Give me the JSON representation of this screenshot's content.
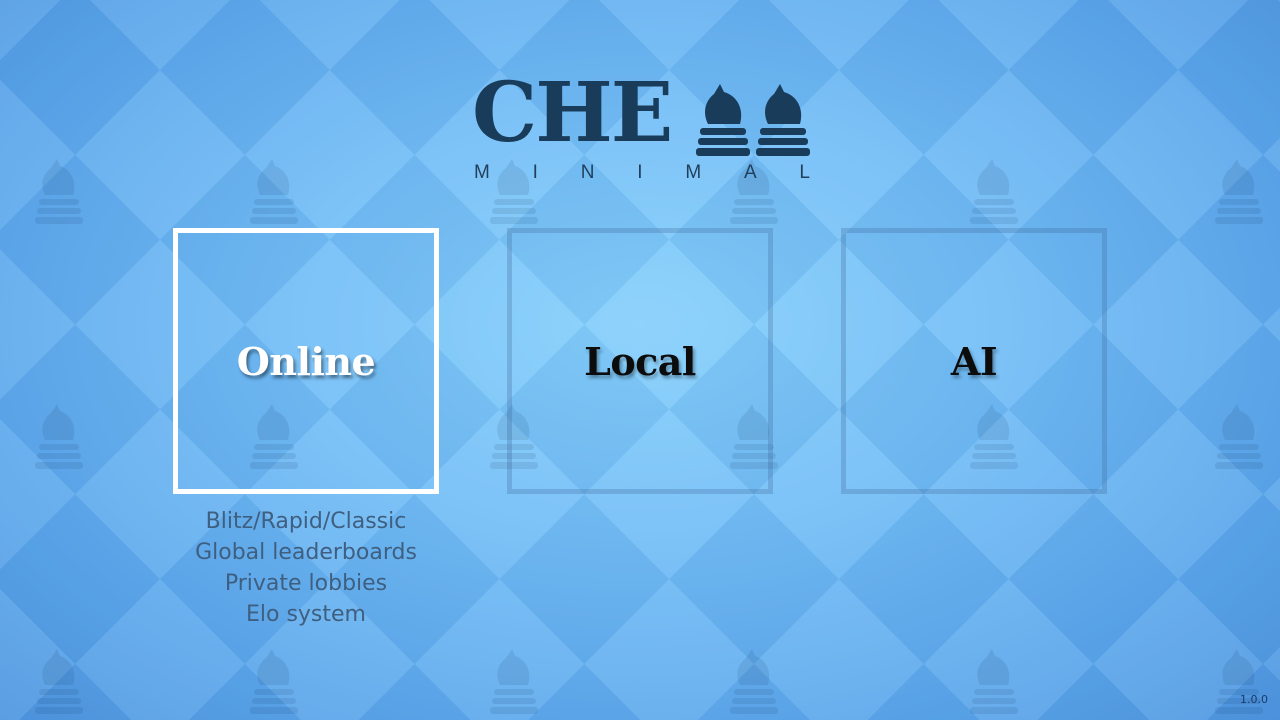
{
  "logo": {
    "word": "CHE",
    "subtitle_letters": [
      "M",
      "I",
      "N",
      "I",
      "M",
      "A",
      "L"
    ],
    "knight_icons": [
      "knight-icon",
      "knight-icon"
    ]
  },
  "modes": [
    {
      "id": "online",
      "label": "Online",
      "selected": true
    },
    {
      "id": "local",
      "label": "Local",
      "selected": false
    },
    {
      "id": "ai",
      "label": "AI",
      "selected": false
    }
  ],
  "online_features": [
    "Blitz/Rapid/Classic",
    "Global leaderboards",
    "Private lobbies",
    "Elo system"
  ],
  "version": "1.0.0",
  "colors": {
    "background_light": "#86d0fc",
    "background_dark": "#4f97e0",
    "logo": "#193c5a",
    "selected_border": "#ffffff",
    "feature_text": "#3f5f80"
  },
  "background_icon": "knight-icon"
}
